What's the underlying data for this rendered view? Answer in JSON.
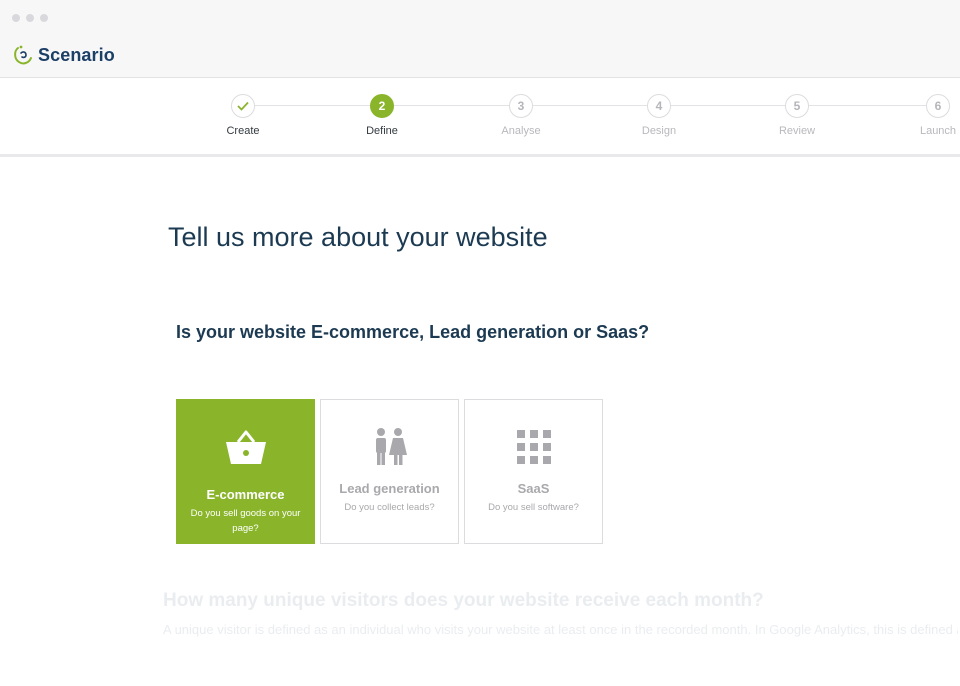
{
  "app": {
    "name": "Scenario"
  },
  "steps": [
    {
      "label": "Create",
      "number": "✓",
      "state": "done"
    },
    {
      "label": "Define",
      "number": "2",
      "state": "active"
    },
    {
      "label": "Analyse",
      "number": "3",
      "state": "pending"
    },
    {
      "label": "Design",
      "number": "4",
      "state": "pending"
    },
    {
      "label": "Review",
      "number": "5",
      "state": "pending"
    },
    {
      "label": "Launch",
      "number": "6",
      "state": "pending"
    }
  ],
  "main": {
    "heading": "Tell us more about your website",
    "question": "Is your website E-commerce, Lead generation or Saas?",
    "options": [
      {
        "title": "E-commerce",
        "subtitle": "Do you sell goods on your page?",
        "icon": "basket-icon",
        "selected": true
      },
      {
        "title": "Lead generation",
        "subtitle": "Do you collect leads?",
        "icon": "people-icon",
        "selected": false
      },
      {
        "title": "SaaS",
        "subtitle": "Do you sell software?",
        "icon": "grid-icon",
        "selected": false
      }
    ],
    "next_question": "How many unique visitors does your website receive each month?",
    "next_description": "A unique visitor is defined as an individual who visits your website at least once in the recorded month. In Google Analytics, this is defined as the number of users."
  },
  "colors": {
    "accent": "#8ab52b",
    "heading": "#1c3a52",
    "brand": "#1c3f66"
  }
}
